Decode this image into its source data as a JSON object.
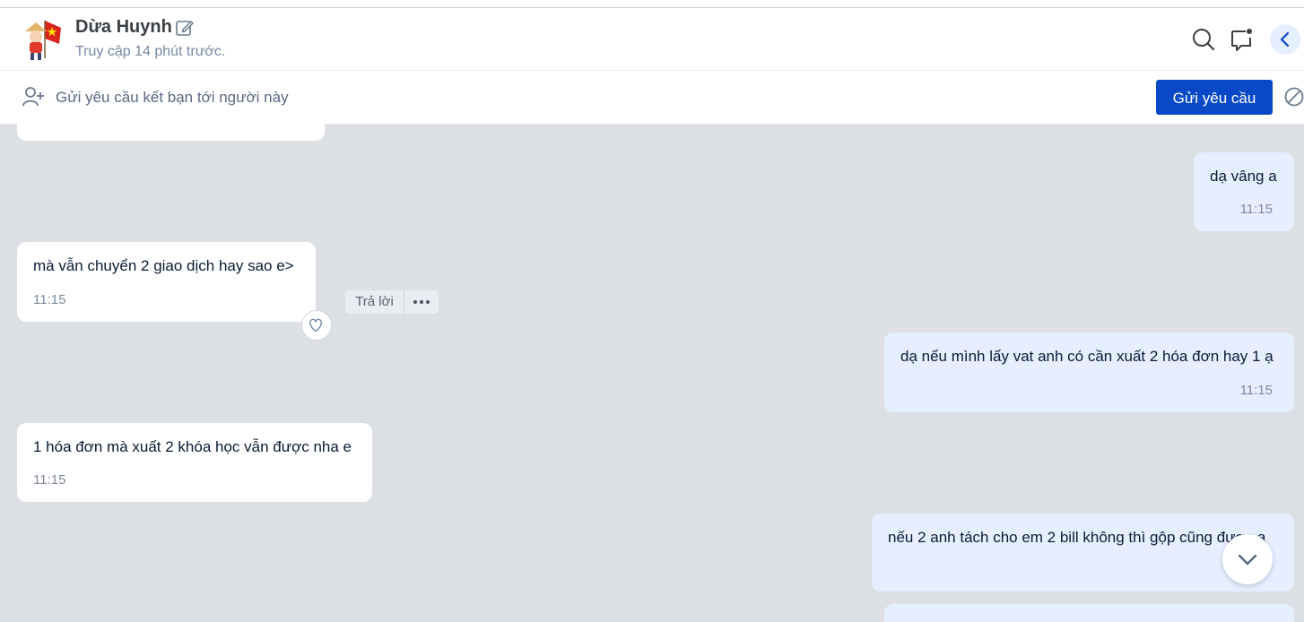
{
  "header": {
    "name": "Dừa Huynh",
    "status": "Truy cập 14 phút trước."
  },
  "friend_bar": {
    "text": "Gửi yêu cầu kết bạn tới người này",
    "button_label": "Gửi yêu cầu"
  },
  "messages": [
    {
      "side": "out",
      "text": "dạ vâng a",
      "time": "11:15"
    },
    {
      "side": "in",
      "text": "mà vẫn chuyển 2 giao dịch hay sao e>",
      "time": "11:15"
    },
    {
      "side": "out",
      "text": "dạ nếu mình lấy vat anh có cần xuất 2 hóa đơn hay 1 ạ",
      "time": "11:15"
    },
    {
      "side": "in",
      "text": "1 hóa đơn mà xuất 2 khóa học vẫn được nha e",
      "time": "11:15"
    },
    {
      "side": "out",
      "text": "nếu 2 anh tách cho em 2 bill không thì gộp cũng được ạ",
      "time": ""
    }
  ],
  "hover_actions": {
    "reply_label": "Trả lời"
  },
  "colors": {
    "accent": "#0849c8",
    "chat_background": "#dcdfe4",
    "outgoing_bubble": "#e5efff",
    "incoming_bubble": "#ffffff"
  }
}
